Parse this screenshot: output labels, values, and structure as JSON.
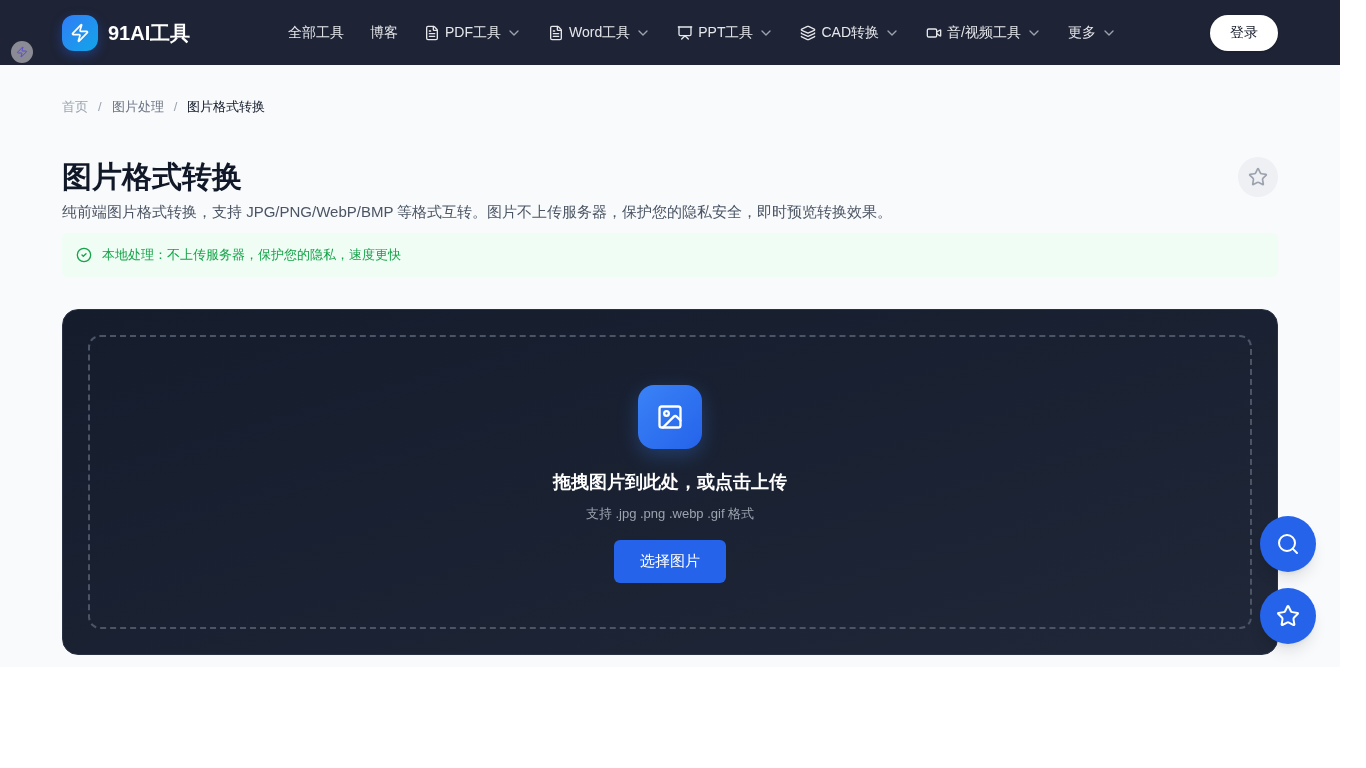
{
  "header": {
    "logo_text": "91AI工具",
    "nav": [
      {
        "label": "全部工具",
        "kind": "plain",
        "dropdown": false
      },
      {
        "label": "博客",
        "kind": "plain",
        "dropdown": false
      },
      {
        "label": "PDF工具",
        "kind": "file",
        "dropdown": true
      },
      {
        "label": "Word工具",
        "kind": "file",
        "dropdown": true
      },
      {
        "label": "PPT工具",
        "kind": "presentation",
        "dropdown": true
      },
      {
        "label": "CAD转换",
        "kind": "layers",
        "dropdown": true
      },
      {
        "label": "音/视频工具",
        "kind": "video",
        "dropdown": true
      },
      {
        "label": "更多",
        "kind": "plain",
        "dropdown": true
      }
    ],
    "login": "登录"
  },
  "breadcrumb": {
    "separator": "/",
    "items": [
      "首页",
      "图片处理",
      "图片格式转换"
    ]
  },
  "title": "图片格式转换",
  "description": "纯前端图片格式转换，支持 JPG/PNG/WebP/BMP 等格式互转。图片不上传服务器，保护您的隐私安全，即时预览转换效果。",
  "notice": "本地处理：不上传服务器，保护您的隐私，速度更快",
  "upload": {
    "heading": "拖拽图片到此处，或点击上传",
    "hint": "支持 .jpg .png .webp .gif 格式",
    "button": "选择图片"
  }
}
